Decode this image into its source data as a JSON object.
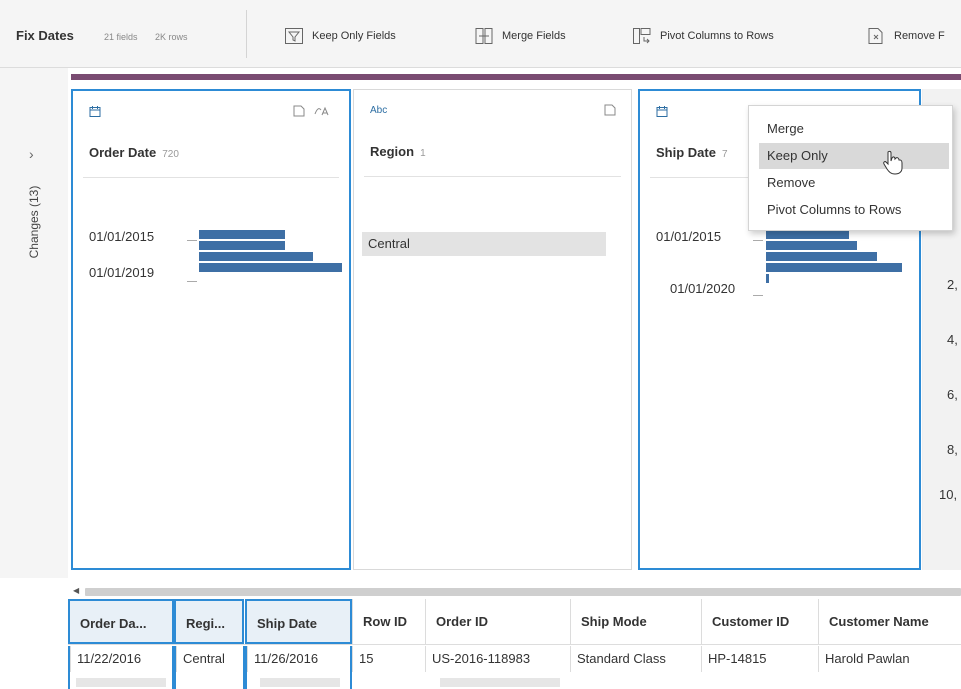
{
  "toolbar": {
    "step_name": "Fix Dates",
    "field_count": "21 fields",
    "row_count": "2K rows",
    "buttons": [
      {
        "label": "Keep Only Fields",
        "icon": "filter-icon"
      },
      {
        "label": "Merge Fields",
        "icon": "merge-fields-icon"
      },
      {
        "label": "Pivot Columns to Rows",
        "icon": "pivot-icon"
      },
      {
        "label": "Remove F",
        "icon": "remove-field-icon"
      }
    ]
  },
  "sidebar": {
    "changes_label": "Changes (13)"
  },
  "cards": [
    {
      "type_icon": "calendar-icon",
      "name": "Order Date",
      "count": "720",
      "labels": [
        "01/01/2015",
        "01/01/2019"
      ],
      "bin_fractions": [
        0.59,
        0.59,
        0.78,
        0.98
      ]
    },
    {
      "type_label": "Abc",
      "name": "Region",
      "count": "1",
      "values": [
        "Central"
      ]
    },
    {
      "type_icon": "calendar-icon",
      "name": "Ship Date",
      "count": "7",
      "labels": [
        "01/01/2015",
        "01/01/2020"
      ],
      "bin_fractions": [
        0.57,
        0.62,
        0.76,
        0.93,
        0.02
      ]
    }
  ],
  "right_column_partial": [
    "2,",
    "4,",
    "6,",
    "8,",
    "10,"
  ],
  "context_menu": {
    "items": [
      "Merge",
      "Keep Only",
      "Remove",
      "Pivot Columns to Rows"
    ],
    "highlighted": "Keep Only"
  },
  "grid": {
    "columns": [
      "Order Da...",
      "Regi...",
      "Ship Date",
      "Row ID",
      "Order ID",
      "Ship Mode",
      "Customer ID",
      "Customer Name"
    ],
    "rows": [
      [
        "11/22/2016",
        "Central",
        "11/26/2016",
        "15",
        "US-2016-118983",
        "Standard Class",
        "HP-14815",
        "Harold Pawlan"
      ]
    ]
  },
  "colors": {
    "accent": "#2d8bd5",
    "bar": "#3e6fa5",
    "step_bar": "#7a4c72"
  }
}
